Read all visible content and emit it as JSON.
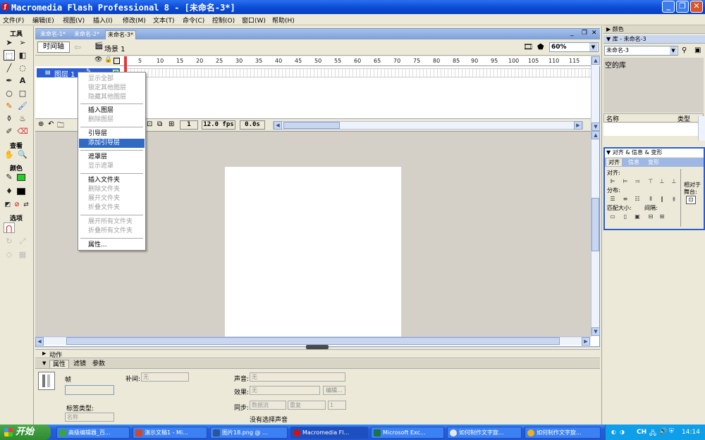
{
  "window": {
    "title": "Macromedia Flash Professional 8 - [未命名-3*]",
    "icon": "flash-app-icon",
    "controls": [
      "minimize-icon",
      "maximize-icon",
      "close-icon"
    ]
  },
  "menu": [
    "文件(F)",
    "编辑(E)",
    "视图(V)",
    "插入(I)",
    "修改(M)",
    "文本(T)",
    "命令(C)",
    "控制(O)",
    "窗口(W)",
    "帮助(H)"
  ],
  "toolbox": {
    "tools_label": "工具",
    "view_label": "查看",
    "colors_label": "颜色",
    "options_label": "选项"
  },
  "doc_tabs": [
    "未命名-1*",
    "未命名-2*",
    "未命名-3*"
  ],
  "docbar": {
    "timeline_button": "时间轴",
    "scene": "场景 1",
    "zoom": "60%"
  },
  "timeline": {
    "ruler": [
      "5",
      "10",
      "15",
      "20",
      "25",
      "30",
      "35",
      "40",
      "45",
      "50",
      "55",
      "60",
      "65",
      "70",
      "75",
      "80",
      "85",
      "90",
      "95",
      "100",
      "105",
      "110",
      "115"
    ],
    "layer_name": "图层 1",
    "frame": "1",
    "fps": "12.0 fps",
    "time": "0.0s"
  },
  "context_menu": [
    {
      "label": "显示全部",
      "disabled": true
    },
    {
      "label": "锁定其他图层",
      "disabled": true
    },
    {
      "label": "隐藏其他图层",
      "disabled": true
    },
    {
      "sep": true
    },
    {
      "label": "插入图层",
      "disabled": false
    },
    {
      "label": "删除图层",
      "disabled": true
    },
    {
      "sep": true
    },
    {
      "label": "引导层",
      "disabled": false
    },
    {
      "label": "添加引导层",
      "disabled": false,
      "highlighted": true
    },
    {
      "sep": true
    },
    {
      "label": "遮罩层",
      "disabled": false
    },
    {
      "label": "显示遮罩",
      "disabled": true
    },
    {
      "sep": true
    },
    {
      "label": "插入文件夹",
      "disabled": false
    },
    {
      "label": "删除文件夹",
      "disabled": true
    },
    {
      "label": "展开文件夹",
      "disabled": true
    },
    {
      "label": "折叠文件夹",
      "disabled": true
    },
    {
      "sep": true
    },
    {
      "label": "展开所有文件夹",
      "disabled": true
    },
    {
      "label": "折叠所有文件夹",
      "disabled": true
    },
    {
      "sep": true
    },
    {
      "label": "属性...",
      "disabled": false
    }
  ],
  "actions_panel": "动作",
  "properties": {
    "tabs": [
      "属性",
      "滤镜",
      "参数"
    ],
    "frame_label": "帧",
    "tween_label": "补间:",
    "tween_value": "无",
    "sound_label": "声音:",
    "sound_value": "无",
    "effect_label": "效果:",
    "effect_value": "无",
    "edit_button": "编辑...",
    "label_type_label": "标签类型:",
    "label_type_value": "名称",
    "sync_label": "同步:",
    "sync_value": "数据流",
    "repeat_value": "重复",
    "repeat_count": "1",
    "no_sound": "没有选择声音"
  },
  "right_panels": {
    "color_header": "颜色",
    "library_header": "库 - 未命名-3",
    "library_select": "未命名-3",
    "library_empty": "空的库",
    "col_name": "名称",
    "col_type": "类型",
    "align_header": "对齐 & 信息 & 变形",
    "align_tabs": [
      "对齐",
      "信息",
      "变形"
    ],
    "align_label": "对齐:",
    "distribute_label": "分布:",
    "match_size_label": "匹配大小:",
    "spacing_label": "间隔:",
    "relative_label": "相对于",
    "stage_label": "舞台:"
  },
  "taskbar": {
    "start": "开始",
    "tasks": [
      {
        "label": "高级编辑器_百...",
        "color": "#3aa53a"
      },
      {
        "label": "演示文稿1 - Mi...",
        "color": "#d24726"
      },
      {
        "label": "图片18.png @ ...",
        "color": "#2b5797"
      },
      {
        "label": "Macromedia Fl...",
        "color": "#d41010",
        "active": true
      },
      {
        "label": "Microsoft Exc...",
        "color": "#1f7244"
      },
      {
        "label": "如何制作文字旋...",
        "color": "#e9e9e9"
      },
      {
        "label": "如何制作文字旋...",
        "color": "#f2b01e"
      }
    ],
    "lang": "CH",
    "clock": "14:14"
  }
}
